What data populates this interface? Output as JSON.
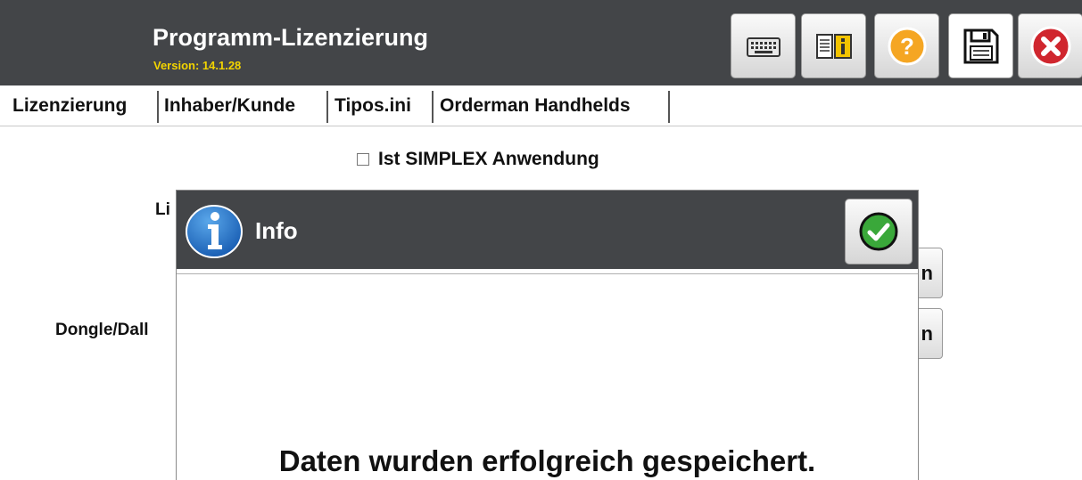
{
  "header": {
    "title": "Programm-Lizenzierung",
    "version": "Version: 14.1.28"
  },
  "toolbar": {
    "icons": [
      "keyboard-icon",
      "manual-info-icon",
      "help-icon",
      "save-icon",
      "close-icon"
    ],
    "colors": {
      "help": "#f5a623",
      "close": "#d0262e"
    }
  },
  "tabs": [
    {
      "label": "Lizenzierung",
      "active": true
    },
    {
      "label": "Inhaber/Kunde",
      "active": false
    },
    {
      "label": "Tipos.ini",
      "active": false
    },
    {
      "label": "Orderman Handhelds",
      "active": false
    }
  ],
  "form": {
    "simplex_label": "Ist SIMPLEX Anwendung",
    "simplex_checked": false,
    "label_1": "Li",
    "label_2": "Dongle/Dall",
    "button_1_text": "n",
    "button_2_text": "n"
  },
  "dialog": {
    "title": "Info",
    "message": "Daten wurden erfolgreich gespeichert.",
    "ok_color": "#3aa83a"
  }
}
